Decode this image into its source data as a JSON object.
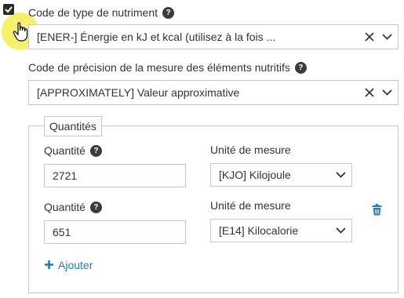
{
  "nutrient_type": {
    "label": "Code de type de nutriment",
    "value": "[ENER-] Énergie en kJ et kcal (utilisez à la fois ...",
    "checked": true
  },
  "precision": {
    "label": "Code de précision de la mesure des éléments nutritifs",
    "value": "[APPROXIMATELY] Valeur approximative"
  },
  "quantities": {
    "legend": "Quantités",
    "rows": [
      {
        "qty_label": "Quantité",
        "qty_value": "2721",
        "unit_label": "Unité de mesure",
        "unit_value": "[KJO] Kilojoule"
      },
      {
        "qty_label": "Quantité",
        "qty_value": "651",
        "unit_label": "Unité de mesure",
        "unit_value": "[E14] Kilocalorie"
      }
    ],
    "add_label": "Ajouter"
  },
  "help_glyph": "?",
  "colors": {
    "accent": "#1a7fc1",
    "cursor_highlight": "#f7f35a"
  }
}
